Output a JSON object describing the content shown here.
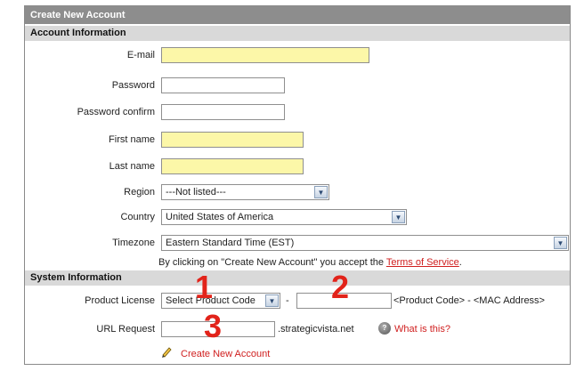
{
  "title": "Create New Account",
  "sections": {
    "account": "Account Information",
    "system": "System Information"
  },
  "fields": {
    "email": {
      "label": "E-mail",
      "value": ""
    },
    "password": {
      "label": "Password",
      "value": ""
    },
    "password_confirm": {
      "label": "Password confirm",
      "value": ""
    },
    "first_name": {
      "label": "First name",
      "value": ""
    },
    "last_name": {
      "label": "Last name",
      "value": ""
    },
    "region": {
      "label": "Region",
      "value": "---Not listed---"
    },
    "country": {
      "label": "Country",
      "value": "United States of America"
    },
    "timezone": {
      "label": "Timezone",
      "value": "Eastern Standard Time (EST)"
    },
    "product_license": {
      "label": "Product License",
      "select_value": "Select Product Code",
      "separator": "-",
      "hint": "<Product Code> - <MAC Address>"
    },
    "url_request": {
      "label": "URL Request",
      "suffix": ".strategicvista.net",
      "help_text": "What is this?"
    }
  },
  "terms": {
    "prefix": "By clicking on \"Create New Account\" you accept the ",
    "link": "Terms of Service",
    "suffix": "."
  },
  "create_button": "Create New Account",
  "callouts": [
    "1",
    "2",
    "3"
  ],
  "colors": {
    "required_bg": "#fcf7a8",
    "title_bg": "#8d8d8d",
    "section_bg": "#d9d9d9",
    "callout": "#e2231a",
    "link": "#d02020"
  }
}
